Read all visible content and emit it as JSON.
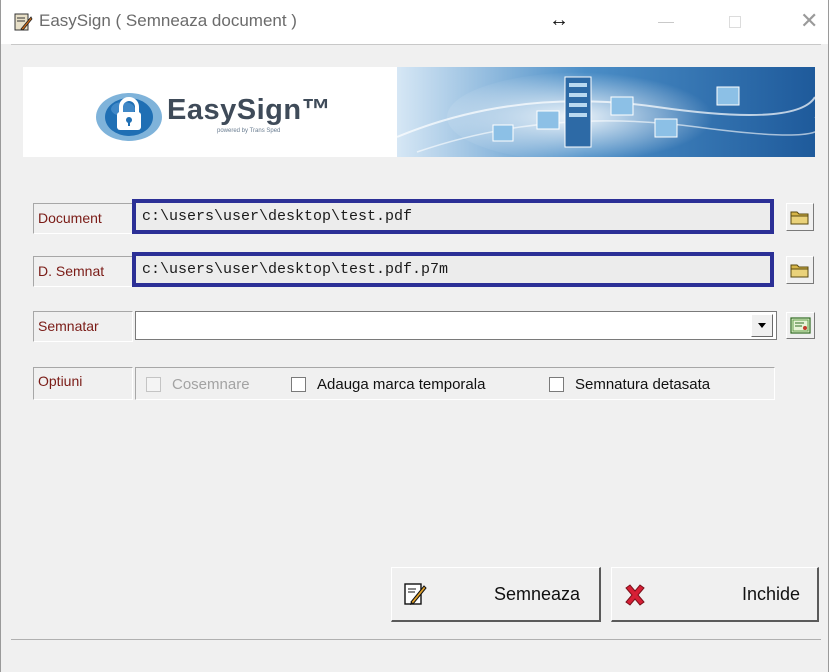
{
  "window": {
    "title": "EasySign ( Semneaza document )",
    "resize_glyph": "↔",
    "close_glyph": "✕"
  },
  "banner": {
    "brand": "EasySign™",
    "tagline": "powered by Trans Sped",
    "accent": "#2b2f96"
  },
  "form": {
    "document": {
      "label": "Document",
      "value": "c:\\users\\user\\desktop\\test.pdf"
    },
    "signed_document": {
      "label": "D. Semnat",
      "value": "c:\\users\\user\\desktop\\test.pdf.p7m"
    },
    "signer": {
      "label": "Semnatar",
      "value": ""
    },
    "options": {
      "label": "Optiuni",
      "cosign": {
        "label": "Cosemnare",
        "checked": false,
        "disabled": true
      },
      "timestamp": {
        "label": "Adauga marca temporala",
        "checked": false
      },
      "detached": {
        "label": "Semnatura detasata",
        "checked": false
      }
    }
  },
  "buttons": {
    "sign": "Semneaza",
    "close": "Inchide"
  },
  "icons": {
    "app": "app-sign-icon",
    "folder": "folder-icon",
    "certificate": "certificate-icon",
    "sign": "sign-document-icon",
    "close": "red-x-icon"
  }
}
